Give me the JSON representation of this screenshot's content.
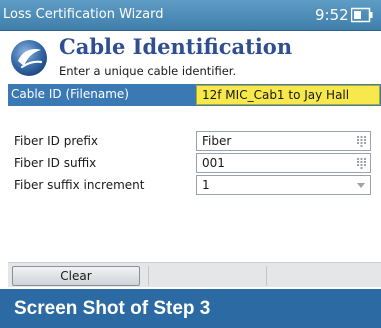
{
  "titlebar": {
    "app_title": "Loss Certification Wizard",
    "time": "9:52",
    "battery_icon": "battery-icon"
  },
  "header": {
    "logo_icon": "exfo-logo-icon",
    "title": "Cable Identification",
    "subtitle": "Enter a unique cable identifier."
  },
  "cable": {
    "label": "Cable ID (Filename)",
    "value": "12f MIC_Cab1 to Jay Hall"
  },
  "fields": [
    {
      "label": "Fiber ID prefix",
      "value": "Fiber",
      "control": "keypad-icon"
    },
    {
      "label": "Fiber ID suffix",
      "value": "001",
      "control": "keypad-icon"
    },
    {
      "label": "Fiber suffix increment",
      "value": "1",
      "control": "chevron-down-icon"
    }
  ],
  "buttons": {
    "clear_label": "Clear"
  },
  "caption": {
    "text": "Screen Shot of Step 3"
  },
  "colors": {
    "titlebar": "#4f8dba",
    "selected_row": "#3a79b3",
    "highlight_input": "#f7e84c",
    "title_text": "#2f4f90",
    "caption_bg": "#2c6aa3"
  }
}
